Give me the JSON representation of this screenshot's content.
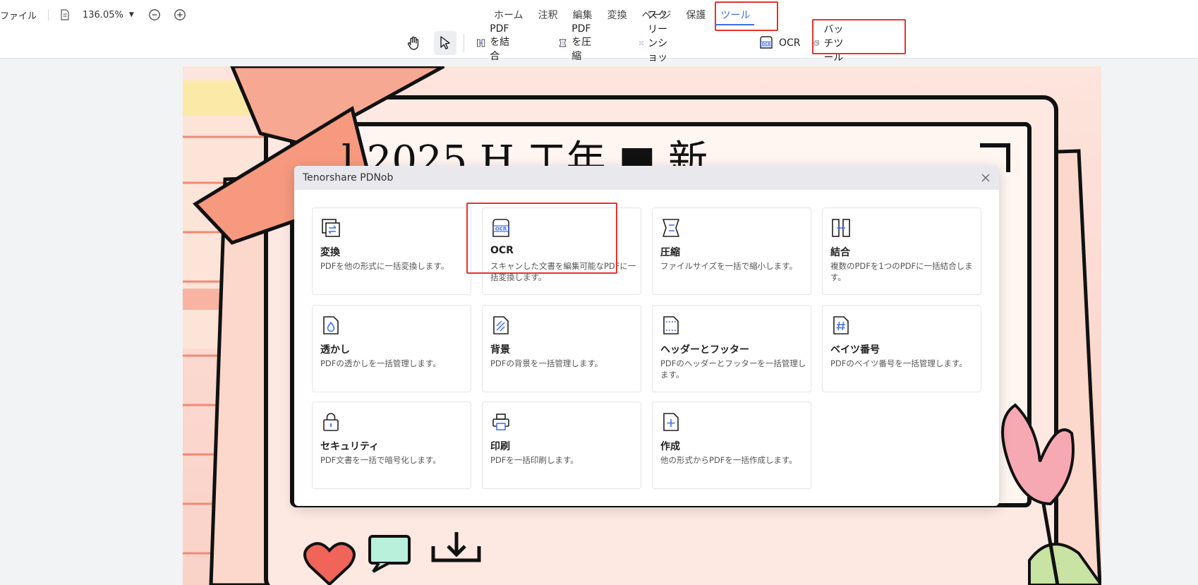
{
  "toolbar": {
    "file_label": "ファイル",
    "zoom_value": "136.05%",
    "menu": [
      "ホーム",
      "注釈",
      "編集",
      "変換",
      "ページ",
      "保護",
      "ツール"
    ],
    "active_menu": "ツール",
    "tools": {
      "merge": "PDFを結合",
      "compress": "PDFを圧縮",
      "screenshot": "スクリーンショット",
      "ocr": "OCR",
      "batch": "バッチツール"
    }
  },
  "dialog": {
    "title": "Tenorshare PDNob",
    "cards": [
      {
        "title": "変換",
        "desc": "PDFを他の形式に一括変換します。",
        "icon": "convert-icon"
      },
      {
        "title": "OCR",
        "desc": "スキャンした文書を編集可能なPDFに一括変換します。",
        "icon": "ocr-icon"
      },
      {
        "title": "圧縮",
        "desc": "ファイルサイズを一括で縮小します。",
        "icon": "compress-icon"
      },
      {
        "title": "結合",
        "desc": "複数のPDFを1つのPDFに一括結合します。",
        "icon": "merge-icon"
      },
      {
        "title": "透かし",
        "desc": "PDFの透かしを一括管理します。",
        "icon": "watermark-icon"
      },
      {
        "title": "背景",
        "desc": "PDFの背景を一括管理します。",
        "icon": "background-icon"
      },
      {
        "title": "ヘッダーとフッター",
        "desc": "PDFのヘッダーとフッターを一括管理します。",
        "icon": "header-footer-icon"
      },
      {
        "title": "ベイツ番号",
        "desc": "PDFのベイツ番号を一括管理します。",
        "icon": "bates-number-icon"
      },
      {
        "title": "セキュリティ",
        "desc": "PDF文書を一括で暗号化します。",
        "icon": "lock-icon"
      },
      {
        "title": "印刷",
        "desc": "PDFを一括印刷します。",
        "icon": "printer-icon"
      },
      {
        "title": "作成",
        "desc": "他の形式からPDFを一括作成します。",
        "icon": "create-file-icon"
      }
    ]
  },
  "document": {
    "visible_heading_fragment": "l 2025 H  工年 ■ 新"
  },
  "colors": {
    "accent": "#3d6ef0",
    "highlight_box": "#e8322c",
    "dialog_header": "#e9e9ed"
  }
}
